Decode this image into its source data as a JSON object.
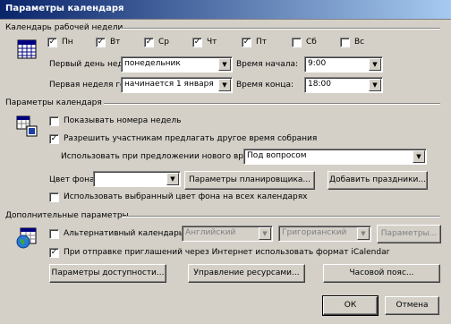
{
  "window": {
    "title": "Параметры календаря"
  },
  "work_week": {
    "title": "Календарь рабочей недели",
    "days": [
      {
        "label": "Пн",
        "checked": true
      },
      {
        "label": "Вт",
        "checked": true
      },
      {
        "label": "Ср",
        "checked": true
      },
      {
        "label": "Чт",
        "checked": true
      },
      {
        "label": "Пт",
        "checked": true
      },
      {
        "label": "Сб",
        "checked": false
      },
      {
        "label": "Вс",
        "checked": false
      }
    ],
    "first_day_label": "Первый день недели:",
    "first_day_value": "понедельник",
    "first_week_label": "Первая неделя года:",
    "first_week_value": "начинается 1 января",
    "start_time_label": "Время начала:",
    "start_time_value": "9:00",
    "end_time_label": "Время конца:",
    "end_time_value": "18:00"
  },
  "calendar_options": {
    "title": "Параметры календаря",
    "show_week_numbers": {
      "label": "Показывать номера недель",
      "checked": false
    },
    "allow_propose": {
      "label": "Разрешить участникам предлагать другое время собрания",
      "checked": true
    },
    "propose_label": "Использовать при предложении нового времени:",
    "propose_value": "Под вопросом",
    "bg_color_label": "Цвет фона:",
    "planner_button": "Параметры планировщика...",
    "holidays_button": "Добавить праздники...",
    "use_color_all": {
      "label": "Использовать выбранный цвет фона на всех календарях",
      "checked": false
    }
  },
  "advanced": {
    "title": "Дополнительные параметры",
    "alt_calendar": {
      "label": "Альтернативный календарь:",
      "checked": false
    },
    "alt_lang_value": "Английский",
    "alt_type_value": "Григорианский",
    "params_button": "Параметры...",
    "icalendar": {
      "label": "При отправке приглашений через Интернет использовать формат iCalendar",
      "checked": true
    },
    "availability_button": "Параметры доступности...",
    "resources_button": "Управление ресурсами...",
    "timezone_button": "Часовой пояс..."
  },
  "footer": {
    "ok": "ОК",
    "cancel": "Отмена"
  }
}
